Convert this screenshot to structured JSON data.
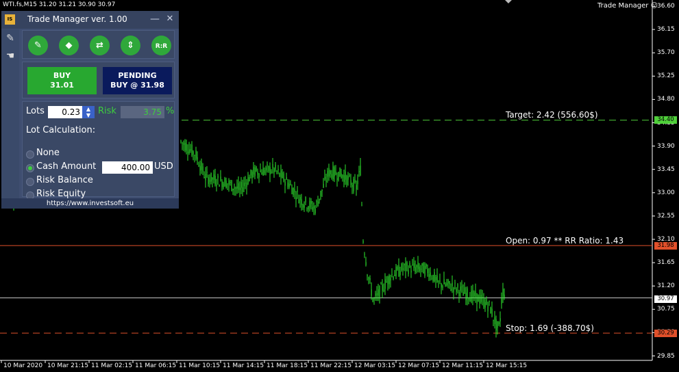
{
  "chart": {
    "symbol_info": "WTI.fs,M15  31.20 31.21 30.90 30.97",
    "indicator_title": "Trade Manager",
    "price_axis": [
      "36.60",
      "36.15",
      "35.70",
      "35.25",
      "34.80",
      "34.35",
      "33.90",
      "33.45",
      "33.00",
      "32.55",
      "32.10",
      "31.65",
      "31.20",
      "30.75",
      "30.30",
      "29.85"
    ],
    "time_axis": [
      "10 Mar 2020",
      "10 Mar 21:15",
      "11 Mar 02:15",
      "11 Mar 06:15",
      "11 Mar 10:15",
      "11 Mar 14:15",
      "11 Mar 18:15",
      "11 Mar 22:15",
      "12 Mar 03:15",
      "12 Mar 07:15",
      "12 Mar 11:15",
      "12 Mar 15:15"
    ],
    "target_line": {
      "text": "Target: 2.42 (556.60$)",
      "price": "34.40",
      "color": "#4fcf3a"
    },
    "open_line": {
      "text": "Open: 0.97 ** RR Ratio: 1.43",
      "price": "31.98",
      "color": "#e0502a"
    },
    "current_line": {
      "price": "30.97",
      "color": "#c8c8c8"
    },
    "stop_line": {
      "text": "Stop: 1.69 (-388.70$)",
      "price": "30.29",
      "color": "#e0502a"
    },
    "candle_color": "#2ee82e"
  },
  "panel": {
    "logo_text": "IS",
    "title": "Trade Manager ver. 1.00",
    "minimize": "—",
    "close": "✕",
    "tools": [
      {
        "name": "pencil-icon",
        "glyph": "✎"
      },
      {
        "name": "eraser-icon",
        "glyph": "◆"
      },
      {
        "name": "reverse-icon",
        "glyph": "⇄"
      },
      {
        "name": "range-icon",
        "glyph": "⇕"
      },
      {
        "name": "rr-icon",
        "glyph": "R:R"
      }
    ],
    "buy": {
      "line1": "BUY",
      "line2": "31.01"
    },
    "pending": {
      "line1": "PENDING",
      "line2": "BUY @ 31.98"
    },
    "lots_label": "Lots",
    "lots_value": "0.23",
    "risk_label": "Risk",
    "risk_value": "3.75",
    "risk_unit": "%",
    "lot_calc_label": "Lot Calculation:",
    "options": [
      {
        "label": "None",
        "selected": false
      },
      {
        "label": "Cash Amount",
        "selected": true
      },
      {
        "label": "Risk Balance",
        "selected": false
      },
      {
        "label": "Risk Equity",
        "selected": false
      }
    ],
    "cash_value": "400.00",
    "cash_unit": "USD",
    "footer": "https://www.investsoft.eu"
  }
}
